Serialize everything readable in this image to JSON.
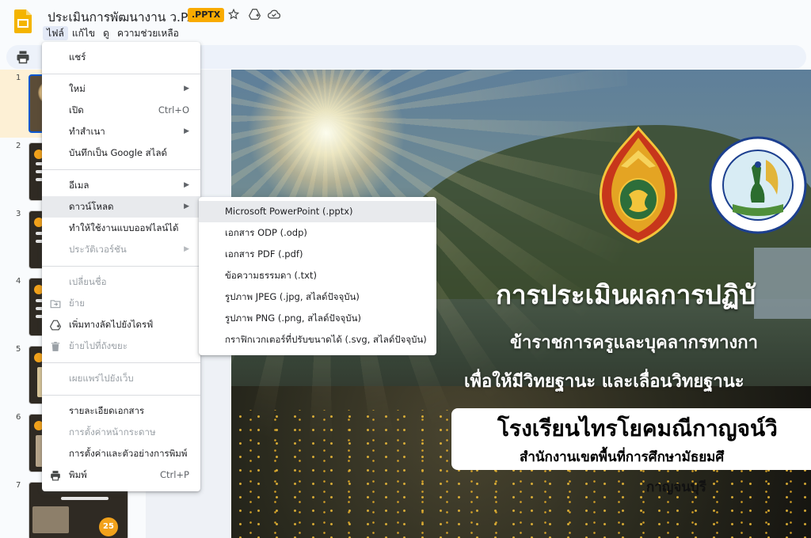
{
  "header": {
    "doc_title": "ประเมินการพัฒนางาน ว.PA",
    "file_badge": ".PPTX",
    "icons": [
      "star-icon",
      "move-to-drive-icon",
      "cloud-status-icon"
    ]
  },
  "menubar": {
    "items": [
      "ไฟล์",
      "แก้ไข",
      "ดู",
      "ความช่วยเหลือ"
    ],
    "active": "ไฟล์"
  },
  "toolbar": {
    "icons": [
      "print-icon"
    ]
  },
  "filmstrip": {
    "slides": [
      "1",
      "2",
      "3",
      "4",
      "5",
      "6",
      "7"
    ],
    "selected": "1",
    "thumb7_badge": "25"
  },
  "file_menu": {
    "share": "แชร์",
    "new": "ใหม่",
    "open": "เปิด",
    "open_shortcut": "Ctrl+O",
    "make_copy": "ทำสำเนา",
    "save_as_slides": "บันทึกเป็น Google สไลด์",
    "email": "อีเมล",
    "download": "ดาวน์โหลด",
    "offline": "ทำให้ใช้งานแบบออฟไลน์ได้",
    "version_history": "ประวัติเวอร์ชัน",
    "rename": "เปลี่ยนชื่อ",
    "move": "ย้าย",
    "add_shortcut": "เพิ่มทางลัดไปยังไดรฟ์",
    "trash": "ย้ายไปที่ถังขยะ",
    "publish": "เผยแพร่ไปยังเว็บ",
    "details": "รายละเอียดเอกสาร",
    "page_setup": "การตั้งค่าหน้ากระดาษ",
    "print_settings": "การตั้งค่าและตัวอย่างการพิมพ์",
    "print": "พิมพ์",
    "print_shortcut": "Ctrl+P"
  },
  "download_menu": {
    "items": [
      "Microsoft PowerPoint (.pptx)",
      "เอกสาร ODP (.odp)",
      "เอกสาร PDF (.pdf)",
      "ข้อความธรรมดา (.txt)",
      "รูปภาพ JPEG (.jpg, สไลด์ปัจจุบัน)",
      "รูปภาพ PNG (.png, สไลด์ปัจจุบัน)",
      "กราฟิกเวกเตอร์ที่ปรับขนาดได้ (.svg, สไลด์ปัจจุบัน)"
    ],
    "hovered": "Microsoft PowerPoint (.pptx)"
  },
  "slide": {
    "title": "การประเมินผลการปฏิบั",
    "subtitle1": "ข้าราชการครูและบุคลากรทางกา",
    "subtitle2": "เพื่อให้มีวิทยฐานะ และเลื่อนวิทยฐานะ",
    "school_name": "โรงเรียนไทรโยคมณีกาญจน์วิ",
    "office": "สำนักงานเขตพื้นที่การศึกษามัธยมศึ",
    "province": "กาญจนบุรี",
    "emblem_right_ring_text": "สุจิปุลิ ความรู้ ความดี วิชาเป็นเลิศ",
    "emblem_right_bottom_text": "โรงเรียนไทรโยคมณีกาญจน์วิทยา"
  },
  "colors": {
    "badge": "#f9ab00",
    "menu_hover": "#e8eaed",
    "selection_border": "#0b57d0",
    "slide1_highlight": "#fdf0d5"
  }
}
